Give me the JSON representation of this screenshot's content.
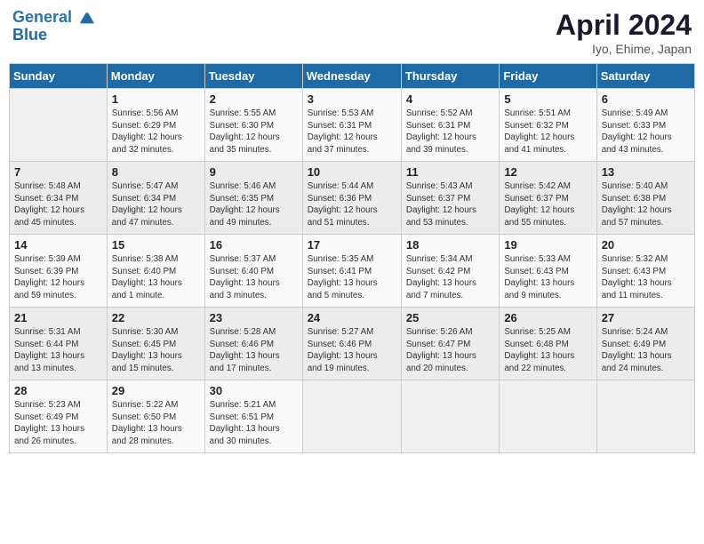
{
  "header": {
    "logo_line1": "General",
    "logo_line2": "Blue",
    "month": "April 2024",
    "location": "Iyo, Ehime, Japan"
  },
  "days_of_week": [
    "Sunday",
    "Monday",
    "Tuesday",
    "Wednesday",
    "Thursday",
    "Friday",
    "Saturday"
  ],
  "weeks": [
    [
      {
        "num": "",
        "info": ""
      },
      {
        "num": "1",
        "info": "Sunrise: 5:56 AM\nSunset: 6:29 PM\nDaylight: 12 hours\nand 32 minutes."
      },
      {
        "num": "2",
        "info": "Sunrise: 5:55 AM\nSunset: 6:30 PM\nDaylight: 12 hours\nand 35 minutes."
      },
      {
        "num": "3",
        "info": "Sunrise: 5:53 AM\nSunset: 6:31 PM\nDaylight: 12 hours\nand 37 minutes."
      },
      {
        "num": "4",
        "info": "Sunrise: 5:52 AM\nSunset: 6:31 PM\nDaylight: 12 hours\nand 39 minutes."
      },
      {
        "num": "5",
        "info": "Sunrise: 5:51 AM\nSunset: 6:32 PM\nDaylight: 12 hours\nand 41 minutes."
      },
      {
        "num": "6",
        "info": "Sunrise: 5:49 AM\nSunset: 6:33 PM\nDaylight: 12 hours\nand 43 minutes."
      }
    ],
    [
      {
        "num": "7",
        "info": "Sunrise: 5:48 AM\nSunset: 6:34 PM\nDaylight: 12 hours\nand 45 minutes."
      },
      {
        "num": "8",
        "info": "Sunrise: 5:47 AM\nSunset: 6:34 PM\nDaylight: 12 hours\nand 47 minutes."
      },
      {
        "num": "9",
        "info": "Sunrise: 5:46 AM\nSunset: 6:35 PM\nDaylight: 12 hours\nand 49 minutes."
      },
      {
        "num": "10",
        "info": "Sunrise: 5:44 AM\nSunset: 6:36 PM\nDaylight: 12 hours\nand 51 minutes."
      },
      {
        "num": "11",
        "info": "Sunrise: 5:43 AM\nSunset: 6:37 PM\nDaylight: 12 hours\nand 53 minutes."
      },
      {
        "num": "12",
        "info": "Sunrise: 5:42 AM\nSunset: 6:37 PM\nDaylight: 12 hours\nand 55 minutes."
      },
      {
        "num": "13",
        "info": "Sunrise: 5:40 AM\nSunset: 6:38 PM\nDaylight: 12 hours\nand 57 minutes."
      }
    ],
    [
      {
        "num": "14",
        "info": "Sunrise: 5:39 AM\nSunset: 6:39 PM\nDaylight: 12 hours\nand 59 minutes."
      },
      {
        "num": "15",
        "info": "Sunrise: 5:38 AM\nSunset: 6:40 PM\nDaylight: 13 hours\nand 1 minute."
      },
      {
        "num": "16",
        "info": "Sunrise: 5:37 AM\nSunset: 6:40 PM\nDaylight: 13 hours\nand 3 minutes."
      },
      {
        "num": "17",
        "info": "Sunrise: 5:35 AM\nSunset: 6:41 PM\nDaylight: 13 hours\nand 5 minutes."
      },
      {
        "num": "18",
        "info": "Sunrise: 5:34 AM\nSunset: 6:42 PM\nDaylight: 13 hours\nand 7 minutes."
      },
      {
        "num": "19",
        "info": "Sunrise: 5:33 AM\nSunset: 6:43 PM\nDaylight: 13 hours\nand 9 minutes."
      },
      {
        "num": "20",
        "info": "Sunrise: 5:32 AM\nSunset: 6:43 PM\nDaylight: 13 hours\nand 11 minutes."
      }
    ],
    [
      {
        "num": "21",
        "info": "Sunrise: 5:31 AM\nSunset: 6:44 PM\nDaylight: 13 hours\nand 13 minutes."
      },
      {
        "num": "22",
        "info": "Sunrise: 5:30 AM\nSunset: 6:45 PM\nDaylight: 13 hours\nand 15 minutes."
      },
      {
        "num": "23",
        "info": "Sunrise: 5:28 AM\nSunset: 6:46 PM\nDaylight: 13 hours\nand 17 minutes."
      },
      {
        "num": "24",
        "info": "Sunrise: 5:27 AM\nSunset: 6:46 PM\nDaylight: 13 hours\nand 19 minutes."
      },
      {
        "num": "25",
        "info": "Sunrise: 5:26 AM\nSunset: 6:47 PM\nDaylight: 13 hours\nand 20 minutes."
      },
      {
        "num": "26",
        "info": "Sunrise: 5:25 AM\nSunset: 6:48 PM\nDaylight: 13 hours\nand 22 minutes."
      },
      {
        "num": "27",
        "info": "Sunrise: 5:24 AM\nSunset: 6:49 PM\nDaylight: 13 hours\nand 24 minutes."
      }
    ],
    [
      {
        "num": "28",
        "info": "Sunrise: 5:23 AM\nSunset: 6:49 PM\nDaylight: 13 hours\nand 26 minutes."
      },
      {
        "num": "29",
        "info": "Sunrise: 5:22 AM\nSunset: 6:50 PM\nDaylight: 13 hours\nand 28 minutes."
      },
      {
        "num": "30",
        "info": "Sunrise: 5:21 AM\nSunset: 6:51 PM\nDaylight: 13 hours\nand 30 minutes."
      },
      {
        "num": "",
        "info": ""
      },
      {
        "num": "",
        "info": ""
      },
      {
        "num": "",
        "info": ""
      },
      {
        "num": "",
        "info": ""
      }
    ]
  ]
}
